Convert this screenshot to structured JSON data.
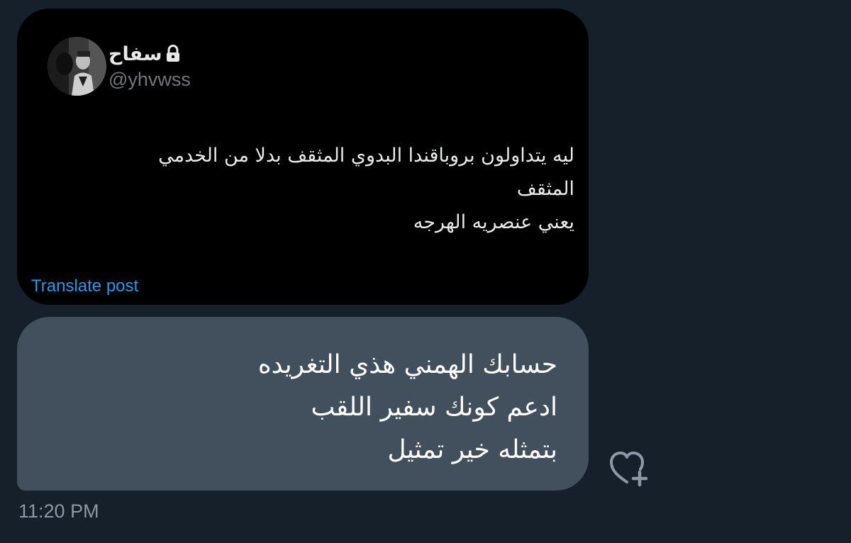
{
  "quoted_post": {
    "author_name": "سفاح",
    "author_handle": "@yhvwss",
    "text_lines": [
      "ليه يتداولون بروباقندا البدوي المثقف بدلا من الخدمي",
      "المثقف",
      "يعني عنصريه الهرجه"
    ],
    "translate_label": "Translate post",
    "protected_icon": "lock-icon"
  },
  "message": {
    "text_lines": [
      "حسابك الهمني هذي التغريده",
      "ادعم كونك سفير اللقب",
      "بتمثله خير تمثيل"
    ],
    "timestamp": "11:20 PM",
    "reaction_icon": "heart-plus-icon"
  },
  "colors": {
    "background": "#16202b",
    "card": "#000000",
    "bubble": "#42505e",
    "link": "#1d9bf0",
    "muted": "#71767b"
  }
}
